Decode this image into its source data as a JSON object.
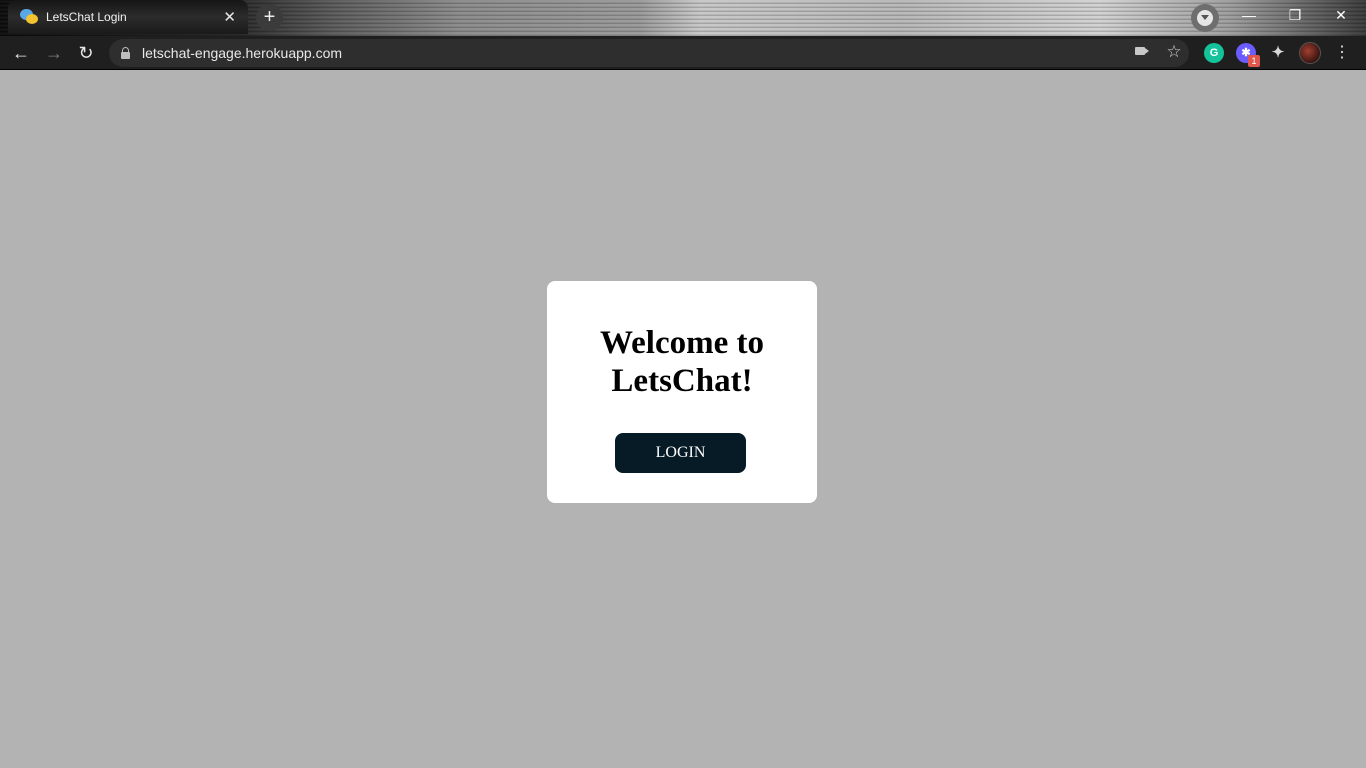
{
  "browser": {
    "tab": {
      "title": "LetsChat Login",
      "close_glyph": "✕",
      "favicon": "chat-bubbles-icon"
    },
    "new_tab_glyph": "+",
    "window_controls": {
      "minimize": "—",
      "maximize": "❐",
      "close": "✕"
    },
    "nav": {
      "back": "←",
      "forward": "→",
      "reload": "↻"
    },
    "address_bar": {
      "url": "letschat-engage.herokuapp.com"
    },
    "toolbar_icons": {
      "star": "☆",
      "grammarly": "G",
      "puzzle": "✦",
      "kebab": "⋮",
      "badge_count": "1"
    }
  },
  "page": {
    "background_color": "#b3b3b3",
    "card": {
      "heading": "Welcome to LetsChat!",
      "login_label": "LOGIN",
      "button_color": "#071b27"
    }
  }
}
